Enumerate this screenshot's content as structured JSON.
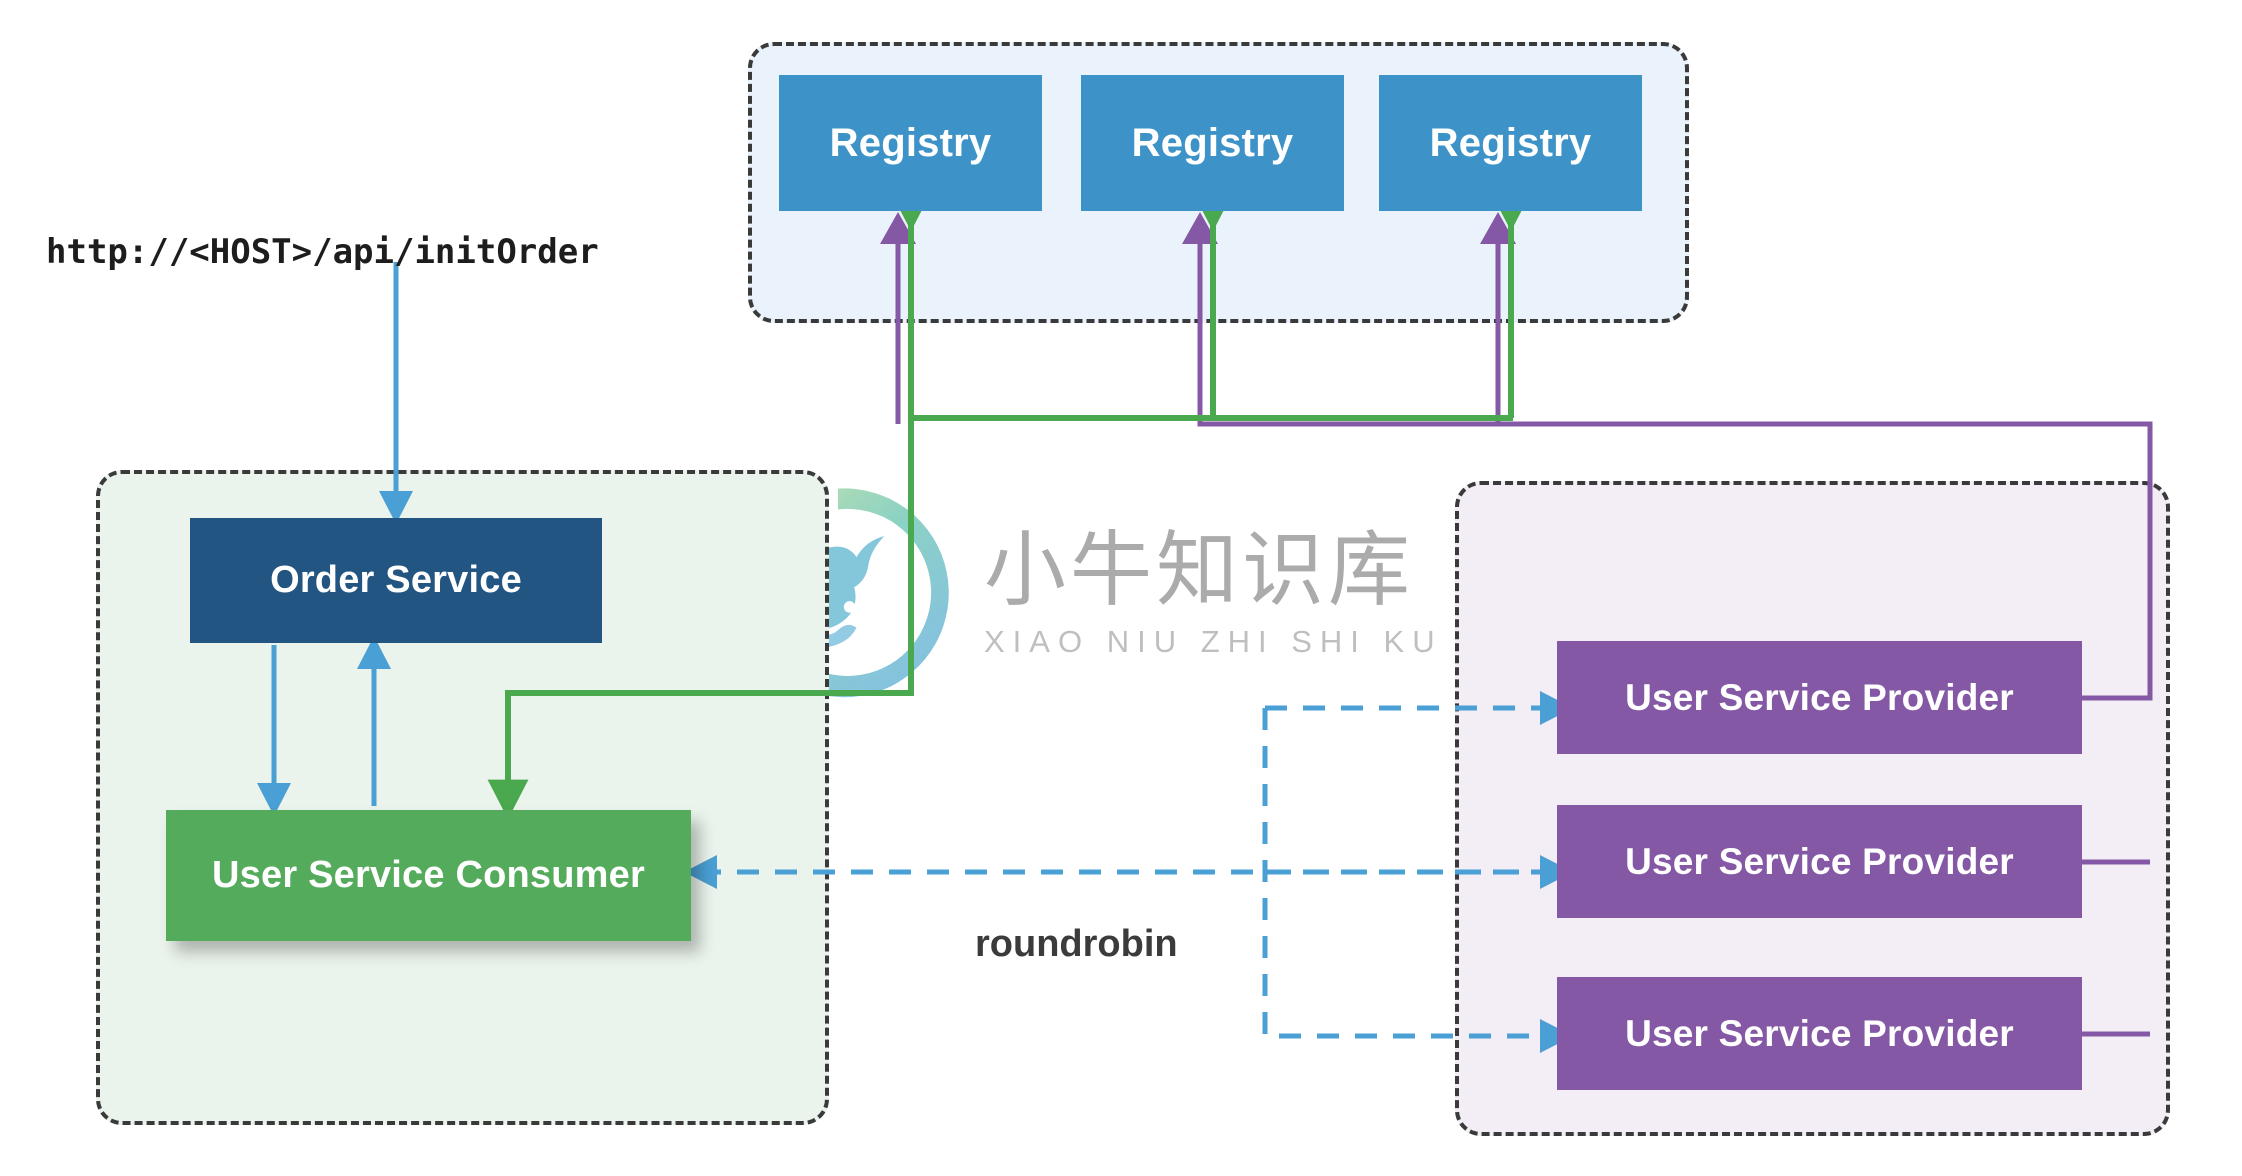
{
  "diagram": {
    "url_label": "http://<HOST>/api/initOrder",
    "roundrobin_label": "roundrobin"
  },
  "registry_group": {
    "name": "registry-cluster",
    "background": "#eaf2fb",
    "nodes": [
      {
        "label": "Registry"
      },
      {
        "label": "Registry"
      },
      {
        "label": "Registry"
      }
    ]
  },
  "consumer_group": {
    "name": "consumer-application",
    "background": "#eaf3ec",
    "order_service": {
      "label": "Order Service",
      "color": "#225581"
    },
    "user_service_consumer": {
      "label": "User Service Consumer",
      "color": "#55ab5c"
    }
  },
  "provider_group": {
    "name": "provider-cluster",
    "background": "#f3eef5",
    "nodes": [
      {
        "label": "User Service Provider",
        "color": "#8458a4"
      },
      {
        "label": "User Service Provider",
        "color": "#8458a4"
      },
      {
        "label": "User Service Provider",
        "color": "#8458a4"
      }
    ]
  },
  "watermark": {
    "chinese": "小牛知识库",
    "pinyin": "XIAO NIU ZHI SHI KU"
  },
  "colors": {
    "registry_blue": "#3d93c8",
    "order_navy": "#225581",
    "consumer_green": "#55ab5c",
    "provider_purple": "#8458a4",
    "arrow_blue": "#4a9fd4",
    "arrow_green": "#4aa84f",
    "arrow_purple": "#8458a4",
    "dash_border": "#3a3a3a"
  }
}
